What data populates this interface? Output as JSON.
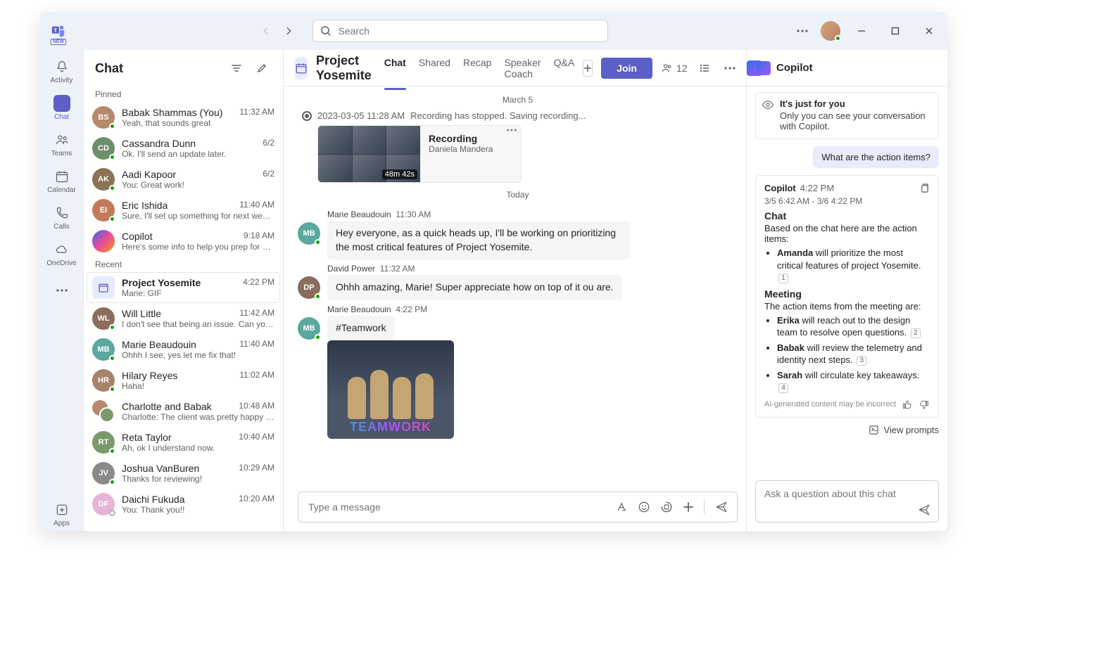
{
  "titlebar": {
    "search_placeholder": "Search"
  },
  "rail": {
    "items": [
      {
        "id": "activity",
        "label": "Activity"
      },
      {
        "id": "chat",
        "label": "Chat"
      },
      {
        "id": "teams",
        "label": "Teams"
      },
      {
        "id": "calendar",
        "label": "Calendar"
      },
      {
        "id": "calls",
        "label": "Calls"
      },
      {
        "id": "onedrive",
        "label": "OneDrive"
      }
    ],
    "apps_label": "Apps"
  },
  "chatlist": {
    "title": "Chat",
    "pinned_label": "Pinned",
    "recent_label": "Recent",
    "pinned": [
      {
        "name": "Babak Shammas (You)",
        "preview": "Yeah, that sounds great",
        "time": "11:32 AM",
        "initials": "BS",
        "color": "#b5896b"
      },
      {
        "name": "Cassandra Dunn",
        "preview": "Ok. I'll send an update later.",
        "time": "6/2",
        "initials": "CD",
        "color": "#6b8e6b"
      },
      {
        "name": "Aadi Kapoor",
        "preview": "You: Great work!",
        "time": "6/2",
        "initials": "AK",
        "color": "#8a7355"
      },
      {
        "name": "Eric Ishida",
        "preview": "Sure, I'll set up something for next week t…",
        "time": "11:40 AM",
        "initials": "EI",
        "color": "#c47a5a"
      },
      {
        "name": "Copilot",
        "preview": "Here's some info to help you prep for your…",
        "time": "9:18 AM",
        "initials": "",
        "copilot": true
      }
    ],
    "recent": [
      {
        "name": "Project Yosemite",
        "preview": "Marie: GIF",
        "time": "4:22 PM",
        "square": true
      },
      {
        "name": "Will Little",
        "preview": "I don't see that being an issue. Can you ta…",
        "time": "11:42 AM",
        "initials": "WL",
        "color": "#8a6d5a"
      },
      {
        "name": "Marie Beaudouin",
        "preview": "Ohhh I see, yes let me fix that!",
        "time": "11:40 AM",
        "initials": "MB",
        "color": "#5ba89e"
      },
      {
        "name": "Hilary Reyes",
        "preview": "Haha!",
        "time": "11:02 AM",
        "initials": "HR",
        "color": "#a8826b"
      },
      {
        "name": "Charlotte and Babak",
        "preview": "Charlotte: The client was pretty happy with…",
        "time": "10:48 AM",
        "group": true
      },
      {
        "name": "Reta Taylor",
        "preview": "Ah, ok I understand now.",
        "time": "10:40 AM",
        "initials": "RT",
        "color": "#7a9a6b"
      },
      {
        "name": "Joshua VanBuren",
        "preview": "Thanks for reviewing!",
        "time": "10:29 AM",
        "initials": "JV",
        "color": "#8a8a8a"
      },
      {
        "name": "Daichi Fukuda",
        "preview": "You: Thank you!!",
        "time": "10:20 AM",
        "initials": "DF",
        "color": "#e6b3d9",
        "away": true
      }
    ]
  },
  "conversation": {
    "title": "Project Yosemite",
    "tabs": [
      "Chat",
      "Shared",
      "Recap",
      "Speaker Coach",
      "Q&A"
    ],
    "join_label": "Join",
    "participants": "12",
    "date_divider": "March 5",
    "recording_ts": "2023-03-05 11:28 AM",
    "recording_msg": "Recording has stopped. Saving recording...",
    "recording": {
      "title": "Recording",
      "by": "Daniela Mandera",
      "duration": "48m 42s"
    },
    "today_divider": "Today",
    "messages": [
      {
        "author": "Marie Beaudouin",
        "time": "11:30 AM",
        "initials": "MB",
        "color": "#5ba89e",
        "text": "Hey everyone, as a quick heads up, I'll be working on prioritizing the most critical features of Project Yosemite."
      },
      {
        "author": "David Power",
        "time": "11:32 AM",
        "initials": "DP",
        "color": "#8a6d5a",
        "text": "Ohhh amazing, Marie! Super appreciate how on top of it ou are."
      },
      {
        "author": "Marie Beaudouin",
        "time": "4:22 PM",
        "initials": "MB",
        "color": "#5ba89e",
        "text": "#Teamwork",
        "gif": true,
        "gif_caption": "TEAMWORK"
      }
    ],
    "compose_placeholder": "Type a message"
  },
  "copilot": {
    "title": "Copilot",
    "notice_title": "It's just for you",
    "notice_text": "Only you can see your conversation with Copilot.",
    "user_question": "What are the action items?",
    "response": {
      "author": "Copilot",
      "time": "4:22 PM",
      "range": "3/5 6:42 AM - 3/6 4:22 PM",
      "chat_heading": "Chat",
      "chat_intro": "Based on the chat here are the action items:",
      "chat_items": [
        {
          "who": "Amanda",
          "text": " will prioritize the most critical features of project Yosemite.",
          "ref": "1"
        }
      ],
      "meeting_heading": "Meeting",
      "meeting_intro": "The action items from the meeting are:",
      "meeting_items": [
        {
          "who": "Erika",
          "text": " will reach out to the design team to resolve open questions.",
          "ref": "2"
        },
        {
          "who": "Babak",
          "text": " will review the telemetry and identity next steps.",
          "ref": "3"
        },
        {
          "who": "Sarah",
          "text": " will circulate key takeaways.",
          "ref": "4"
        }
      ],
      "disclaimer": "AI-generated content may be incorrect"
    },
    "view_prompts": "View prompts",
    "input_placeholder": "Ask a question about this chat"
  }
}
